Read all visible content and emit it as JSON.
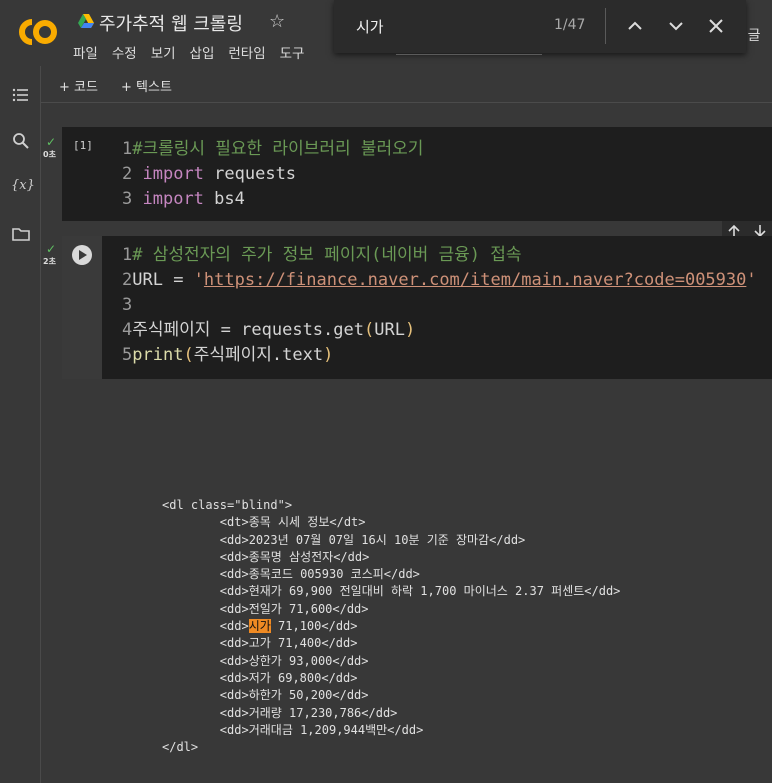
{
  "header": {
    "title": "주가추적 웹 크롤링",
    "menu": [
      "파일",
      "수정",
      "보기",
      "삽입",
      "런타임",
      "도구"
    ],
    "partial_right": "!글"
  },
  "find": {
    "query": "시가",
    "count": "1/47"
  },
  "toolbar": {
    "code_label": "+ 코드",
    "text_label": "+ 텍스트"
  },
  "cell1": {
    "exec_time": "0초",
    "exec_count": "[1]",
    "lines": [
      {
        "n": "1",
        "comment": "#크롤링시 필요한 라이브러리 불러오기"
      },
      {
        "n": "2",
        "kw": "import",
        "rest": " requests"
      },
      {
        "n": "3",
        "kw": "import",
        "rest": " bs4"
      }
    ]
  },
  "cell2": {
    "exec_time": "2초",
    "line1": {
      "n": "1",
      "comment": "# 삼성전자의 주가 정보 페이지(네이버 금융) 접속"
    },
    "line2": {
      "n": "2",
      "lhs": "URL = ",
      "q": "'",
      "url": "https://finance.naver.com/item/main.naver?code=005930"
    },
    "line3": {
      "n": "3"
    },
    "line4": {
      "n": "4",
      "lhs": "주식페이지 = requests.get",
      "open": "(",
      "arg": "URL",
      "close": ")"
    },
    "line5": {
      "n": "5",
      "fn": "print",
      "open": "(",
      "arg": "주식페이지.text",
      "close": ")"
    }
  },
  "output": {
    "lines": [
      "<dl class=\"blind\">",
      "        <dt>종목 시세 정보</dt>",
      "        <dd>2023년 07월 07일 16시 10분 기준 장마감</dd>",
      "        <dd>종목명 삼성전자</dd>",
      "        <dd>종목코드 005930 코스피</dd>",
      "        <dd>현재가 69,900 전일대비 하락 1,700 마이너스 2.37 퍼센트</dd>",
      "        <dd>전일가 71,600</dd>"
    ],
    "hl_prefix": "        <dd>",
    "hl_word": "시가",
    "hl_suffix": " 71,100</dd>",
    "lines_after": [
      "        <dd>고가 71,400</dd>",
      "        <dd>상한가 93,000</dd>",
      "        <dd>저가 69,800</dd>",
      "        <dd>하한가 50,200</dd>",
      "        <dd>거래량 17,230,786</dd>",
      "        <dd>거래대금 1,209,944백만</dd>",
      "</dl>"
    ]
  },
  "colors": {
    "logo_orange": "#f9ab00",
    "highlight": "#ef8a23",
    "check_green": "#5fbf62"
  }
}
